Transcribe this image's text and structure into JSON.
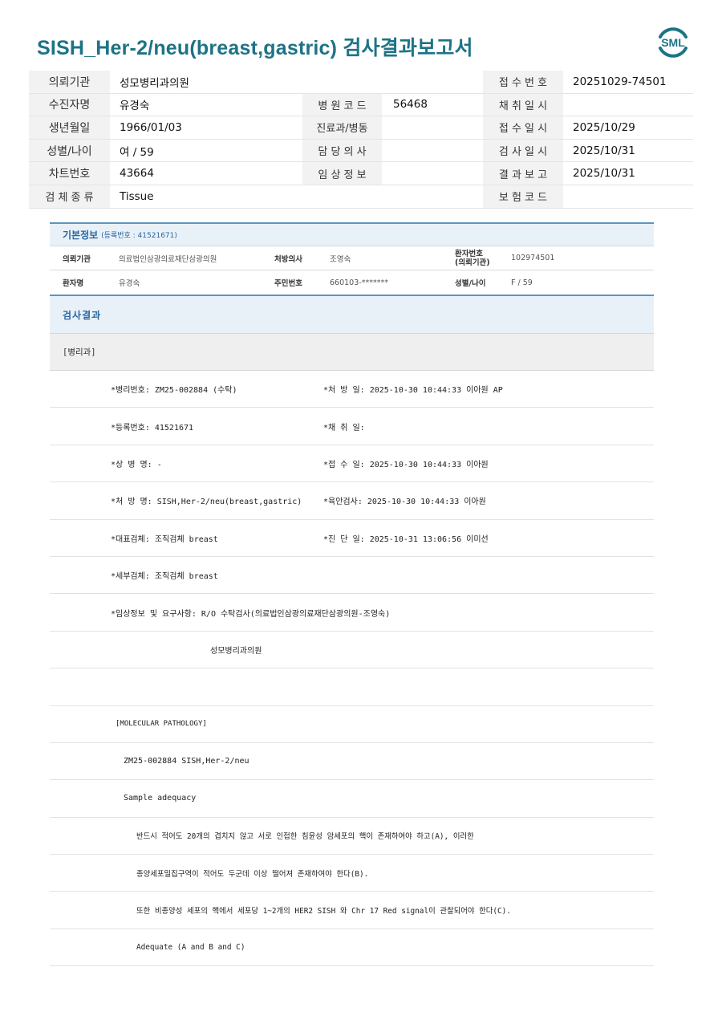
{
  "title": "SISH_Her-2/neu(breast,gastric) 검사결과보고서",
  "logo": {
    "text": "SML",
    "color": "#1d7386"
  },
  "info_rows": [
    {
      "l1": "의뢰기관",
      "v1": "성모병리과의원",
      "l2": "",
      "v2": "",
      "l3": "접 수 번 호",
      "v3": "20251029-74501"
    },
    {
      "l1": "수진자명",
      "v1": "유경숙",
      "l2": "병 원 코 드",
      "v2": "56468",
      "l3": "채 취 일 시",
      "v3": ""
    },
    {
      "l1": "생년월일",
      "v1": "1966/01/03",
      "l2": "진료과/병동",
      "v2": "",
      "l3": "접 수 일 시",
      "v3": "2025/10/29"
    },
    {
      "l1": "성별/나이",
      "v1": "여 / 59",
      "l2": "담 당 의 사",
      "v2": "",
      "l3": "검 사 일 시",
      "v3": "2025/10/31"
    },
    {
      "l1": "차트번호",
      "v1": "43664",
      "l2": "임 상 정 보",
      "v2": "",
      "l3": "결 과 보 고",
      "v3": "2025/10/31"
    },
    {
      "l1": "검 체 종 류",
      "v1": "Tissue",
      "l2": "",
      "v2": "",
      "l3": "보 험 코 드",
      "v3": ""
    }
  ],
  "basic": {
    "title": "기본정보",
    "sub": "(등록번호 : 41521671)",
    "rows": [
      {
        "l1": "의뢰기관",
        "v1": "의료법인삼광의료재단삼광의원",
        "l2": "처방의사",
        "v2": "조영숙",
        "l3a": "환자번호",
        "l3b": "(의뢰기관)",
        "v3": "102974501"
      },
      {
        "l1": "환자명",
        "v1": "유경숙",
        "l2": "주민번호",
        "v2": "660103-*******",
        "l3a": "성별/나이",
        "l3b": "",
        "v3": "F / 59"
      }
    ]
  },
  "result": {
    "title": "검사결과",
    "dept": "[병리과]",
    "lines": [
      {
        "a": "*병리번호: ZM25-002884 (수탁)",
        "b": "*처 방 일: 2025-10-30 10:44:33  이아원 AP"
      },
      {
        "a": "*등록번호: 41521671",
        "b": "*채 취 일:"
      },
      {
        "a": "*상 병 명: -",
        "b": "*접 수 일: 2025-10-30 10:44:33  이아원"
      },
      {
        "a": "*처 방 명: SISH,Her-2/neu(breast,gastric)",
        "b": "*육안검사: 2025-10-30 10:44:33  이아원"
      },
      {
        "a": "*대표검체: 조직검체 breast",
        "b": "*진 단 일: 2025-10-31 13:06:56  이미선"
      },
      {
        "a": "*세부검체: 조직검체 breast",
        "b": ""
      },
      {
        "a": "*임상정보 및 요구사항: R/O 수탁검사(의료법인삼광의료재단삼광의원-조영숙)",
        "b": ""
      },
      {
        "a": "성모병리과의원",
        "b": ""
      },
      {
        "a": "",
        "b": ""
      },
      {
        "a": "[MOLECULAR PATHOLOGY]",
        "b": ""
      },
      {
        "a": "ZM25-002884     SISH,Her-2/neu",
        "b": ""
      },
      {
        "a": "Sample adequacy",
        "b": ""
      },
      {
        "a": "반드시 적어도 20개의 겹치지 않고 서로 인접한 침윤성 암세포의 핵이 존재하여야 하고(A), 이러한",
        "b": ""
      },
      {
        "a": "종양세포밀집구역이 적어도 두군데 이상 떨어져 존재하여야 한다(B).",
        "b": ""
      },
      {
        "a": "또한 비종양성 세포의 핵에서 세포당 1~2개의 HER2 SISH 와 Chr 17 Red signal이 관찰되어야 한다(C).",
        "b": ""
      },
      {
        "a": "Adequate (A and B and C)",
        "b": ""
      }
    ]
  }
}
